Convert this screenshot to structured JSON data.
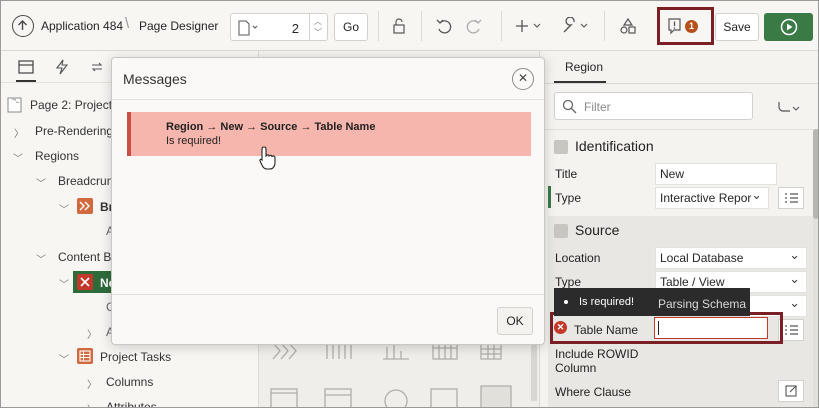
{
  "toolbar": {
    "app_name": "Application 484",
    "separator": "\\",
    "page_designer": "Page Designer",
    "page_number": "2",
    "go_label": "Go",
    "save_label": "Save",
    "message_count": "1"
  },
  "tree": {
    "page_label": "Page 2: Projects",
    "pre_rendering": "Pre-Rendering",
    "regions": "Regions",
    "breadcrumb": "Breadcrum",
    "breadcrumb_child": "Br",
    "breadcrumb_attr": "A",
    "content_body": "Content Bo",
    "new_region": "Ne",
    "columns_short": "C",
    "attributes_short": "A",
    "project_tasks": "Project Tasks",
    "columns": "Columns",
    "attributes": "Attributes"
  },
  "right": {
    "tab_region": "Region",
    "filter_placeholder": "Filter",
    "identification_title": "Identification",
    "title_label": "Title",
    "title_value": "New",
    "type_label": "Type",
    "type_value": "Interactive Repor",
    "source_title": "Source",
    "location_label": "Location",
    "location_value": "Local Database",
    "source_type_label": "Type",
    "source_type_value": "Table / View",
    "table_owner_label": "Ta",
    "table_owner_value": "Parsing Schema",
    "table_name_label": "Table Name",
    "include_rowid_label_1": "Include ROWID",
    "include_rowid_label_2": "Column",
    "where_clause_label": "Where Clause"
  },
  "tooltip": {
    "text": "Is required!"
  },
  "dialog": {
    "title": "Messages",
    "error_path": "Region → New → Source → Table Name",
    "error_message": "Is required!",
    "ok_label": "OK"
  }
}
